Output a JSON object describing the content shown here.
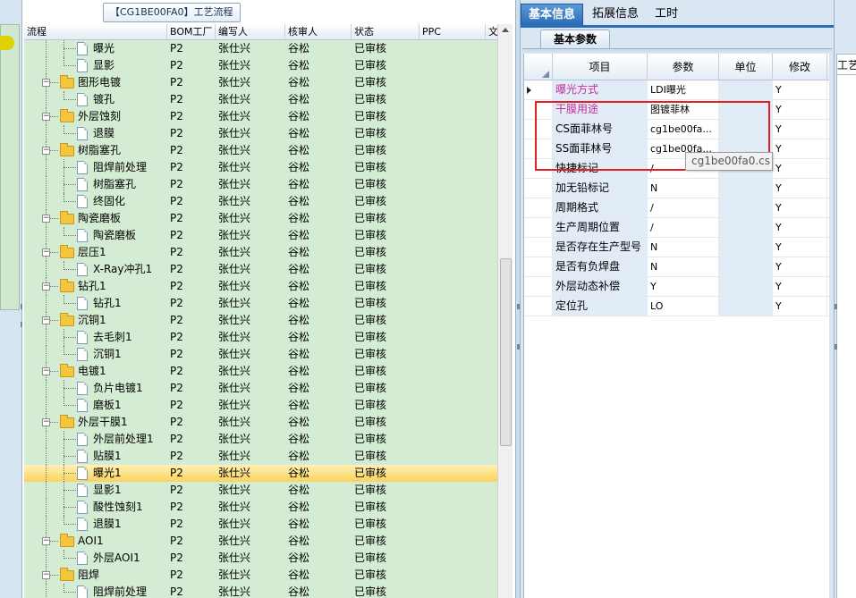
{
  "tree_panel": {
    "title": "【CG1BE00FA0】工艺流程",
    "columns": [
      "流程",
      "BOM工厂",
      "编写人",
      "核审人",
      "状态",
      "PPC",
      "文"
    ],
    "rows": [
      {
        "level": 2,
        "type": "doc",
        "name": "曝光",
        "bom": "P2",
        "author": "张仕兴",
        "reviewer": "谷松",
        "status": "已审核"
      },
      {
        "level": 2,
        "type": "doc",
        "name": "显影",
        "bom": "P2",
        "author": "张仕兴",
        "reviewer": "谷松",
        "status": "已审核"
      },
      {
        "level": 1,
        "type": "folder",
        "name": "图形电镀",
        "bom": "P2",
        "author": "张仕兴",
        "reviewer": "谷松",
        "status": "已审核"
      },
      {
        "level": 2,
        "type": "doc",
        "name": "镀孔",
        "bom": "P2",
        "author": "张仕兴",
        "reviewer": "谷松",
        "status": "已审核"
      },
      {
        "level": 1,
        "type": "folder",
        "name": "外层蚀刻",
        "bom": "P2",
        "author": "张仕兴",
        "reviewer": "谷松",
        "status": "已审核"
      },
      {
        "level": 2,
        "type": "doc",
        "name": "退膜",
        "bom": "P2",
        "author": "张仕兴",
        "reviewer": "谷松",
        "status": "已审核"
      },
      {
        "level": 1,
        "type": "folder",
        "name": "树脂塞孔",
        "bom": "P2",
        "author": "张仕兴",
        "reviewer": "谷松",
        "status": "已审核"
      },
      {
        "level": 2,
        "type": "doc",
        "name": "阻焊前处理",
        "bom": "P2",
        "author": "张仕兴",
        "reviewer": "谷松",
        "status": "已审核"
      },
      {
        "level": 2,
        "type": "doc",
        "name": "树脂塞孔",
        "bom": "P2",
        "author": "张仕兴",
        "reviewer": "谷松",
        "status": "已审核"
      },
      {
        "level": 2,
        "type": "doc",
        "name": "终固化",
        "bom": "P2",
        "author": "张仕兴",
        "reviewer": "谷松",
        "status": "已审核"
      },
      {
        "level": 1,
        "type": "folder",
        "name": "陶瓷磨板",
        "bom": "P2",
        "author": "张仕兴",
        "reviewer": "谷松",
        "status": "已审核"
      },
      {
        "level": 2,
        "type": "doc",
        "name": "陶瓷磨板",
        "bom": "P2",
        "author": "张仕兴",
        "reviewer": "谷松",
        "status": "已审核"
      },
      {
        "level": 1,
        "type": "folder",
        "name": "层压1",
        "bom": "P2",
        "author": "张仕兴",
        "reviewer": "谷松",
        "status": "已审核"
      },
      {
        "level": 2,
        "type": "doc",
        "name": "X-Ray冲孔1",
        "bom": "P2",
        "author": "张仕兴",
        "reviewer": "谷松",
        "status": "已审核"
      },
      {
        "level": 1,
        "type": "folder",
        "name": "钻孔1",
        "bom": "P2",
        "author": "张仕兴",
        "reviewer": "谷松",
        "status": "已审核"
      },
      {
        "level": 2,
        "type": "doc",
        "name": "钻孔1",
        "bom": "P2",
        "author": "张仕兴",
        "reviewer": "谷松",
        "status": "已审核"
      },
      {
        "level": 1,
        "type": "folder",
        "name": "沉铜1",
        "bom": "P2",
        "author": "张仕兴",
        "reviewer": "谷松",
        "status": "已审核"
      },
      {
        "level": 2,
        "type": "doc",
        "name": "去毛刺1",
        "bom": "P2",
        "author": "张仕兴",
        "reviewer": "谷松",
        "status": "已审核"
      },
      {
        "level": 2,
        "type": "doc",
        "name": "沉铜1",
        "bom": "P2",
        "author": "张仕兴",
        "reviewer": "谷松",
        "status": "已审核"
      },
      {
        "level": 1,
        "type": "folder",
        "name": "电镀1",
        "bom": "P2",
        "author": "张仕兴",
        "reviewer": "谷松",
        "status": "已审核"
      },
      {
        "level": 2,
        "type": "doc",
        "name": "负片电镀1",
        "bom": "P2",
        "author": "张仕兴",
        "reviewer": "谷松",
        "status": "已审核"
      },
      {
        "level": 2,
        "type": "doc",
        "name": "磨板1",
        "bom": "P2",
        "author": "张仕兴",
        "reviewer": "谷松",
        "status": "已审核"
      },
      {
        "level": 1,
        "type": "folder",
        "name": "外层干膜1",
        "bom": "P2",
        "author": "张仕兴",
        "reviewer": "谷松",
        "status": "已审核"
      },
      {
        "level": 2,
        "type": "doc",
        "name": "外层前处理1",
        "bom": "P2",
        "author": "张仕兴",
        "reviewer": "谷松",
        "status": "已审核"
      },
      {
        "level": 2,
        "type": "doc",
        "name": "贴膜1",
        "bom": "P2",
        "author": "张仕兴",
        "reviewer": "谷松",
        "status": "已审核"
      },
      {
        "level": 2,
        "type": "doc",
        "name": "曝光1",
        "bom": "P2",
        "author": "张仕兴",
        "reviewer": "谷松",
        "status": "已审核",
        "selected": true
      },
      {
        "level": 2,
        "type": "doc",
        "name": "显影1",
        "bom": "P2",
        "author": "张仕兴",
        "reviewer": "谷松",
        "status": "已审核"
      },
      {
        "level": 2,
        "type": "doc",
        "name": "酸性蚀刻1",
        "bom": "P2",
        "author": "张仕兴",
        "reviewer": "谷松",
        "status": "已审核"
      },
      {
        "level": 2,
        "type": "doc",
        "name": "退膜1",
        "bom": "P2",
        "author": "张仕兴",
        "reviewer": "谷松",
        "status": "已审核"
      },
      {
        "level": 1,
        "type": "folder",
        "name": "AOI1",
        "bom": "P2",
        "author": "张仕兴",
        "reviewer": "谷松",
        "status": "已审核"
      },
      {
        "level": 2,
        "type": "doc",
        "name": "外层AOI1",
        "bom": "P2",
        "author": "张仕兴",
        "reviewer": "谷松",
        "status": "已审核"
      },
      {
        "level": 1,
        "type": "folder",
        "name": "阻焊",
        "bom": "P2",
        "author": "张仕兴",
        "reviewer": "谷松",
        "status": "已审核"
      },
      {
        "level": 2,
        "type": "doc",
        "name": "阻焊前处理",
        "bom": "P2",
        "author": "张仕兴",
        "reviewer": "谷松",
        "status": "已审核"
      }
    ]
  },
  "right_panel": {
    "tabs": [
      "基本信息",
      "拓展信息",
      "工时"
    ],
    "active_tab": 0,
    "sub_tab": "基本参数",
    "columns": [
      "项目",
      "参数",
      "单位",
      "修改"
    ],
    "rows": [
      {
        "item": "曝光方式",
        "param": "LDI曝光",
        "unit": "",
        "modify": "Y",
        "highlight": true,
        "current": true
      },
      {
        "item": "干膜用途",
        "param": "图镀菲林",
        "unit": "",
        "modify": "Y",
        "highlight": true
      },
      {
        "item": "CS面菲林号",
        "param": "cg1be00fa...",
        "unit": "",
        "modify": "Y"
      },
      {
        "item": "SS面菲林号",
        "param": "cg1be00fa...",
        "unit": "",
        "modify": "Y"
      },
      {
        "item": "快捷标记",
        "param": "/",
        "unit": "",
        "modify": "Y"
      },
      {
        "item": "加无铅标记",
        "param": "N",
        "unit": "",
        "modify": "Y"
      },
      {
        "item": "周期格式",
        "param": "/",
        "unit": "",
        "modify": "Y"
      },
      {
        "item": "生产周期位置",
        "param": "/",
        "unit": "",
        "modify": "Y"
      },
      {
        "item": "是否存在生产型号",
        "param": "N",
        "unit": "",
        "modify": "Y"
      },
      {
        "item": "是否有负焊盘",
        "param": "N",
        "unit": "",
        "modify": "Y"
      },
      {
        "item": "外层动态补偿",
        "param": "Y",
        "unit": "",
        "modify": "Y"
      },
      {
        "item": "定位孔",
        "param": "LO",
        "unit": "",
        "modify": "Y"
      }
    ],
    "tooltip": "cg1be00fa0.cs"
  },
  "far_right": {
    "tab_label": "工艺"
  },
  "colors": {
    "tree_bg": "#d4ecd4",
    "selected_row": "#fbd35c",
    "active_tab": "#2a6cb5",
    "highlight_text": "#c02f9b",
    "annotation_box": "#e02020"
  },
  "icons": {
    "folder": "folder-icon",
    "doc": "document-icon",
    "expand": "collapse-toggle-icon"
  }
}
